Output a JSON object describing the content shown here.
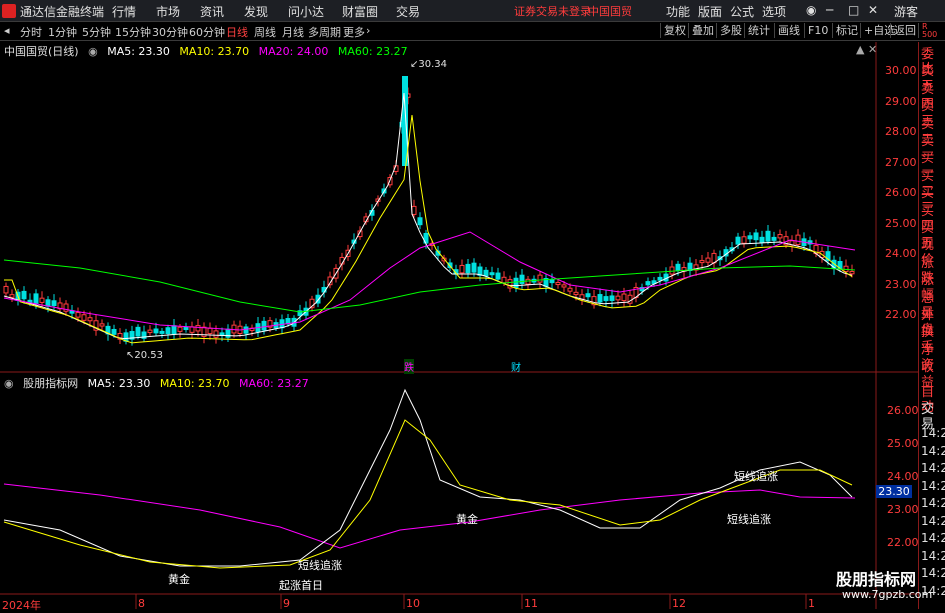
{
  "app": {
    "brand": "通达信金融终端",
    "account": "游客",
    "warn_text": "证券交易未登录",
    "warn_stock": "中国国贸"
  },
  "menu": [
    "行情",
    "市场",
    "资讯",
    "发现",
    "问小达",
    "财富圈",
    "交易"
  ],
  "menu_right": [
    "功能",
    "版面",
    "公式",
    "选项"
  ],
  "periods": [
    "分时",
    "1分钟",
    "5分钟",
    "15分钟",
    "30分钟",
    "60分钟",
    "日线",
    "周线",
    "月线",
    "多周期",
    "更多"
  ],
  "active_period": "日线",
  "tools": [
    "复权",
    "叠加",
    "多股",
    "统计",
    "画线",
    "F10",
    "标记",
    "+自选",
    "返回"
  ],
  "stock": {
    "title": "中国国贸(日线)"
  },
  "ma_legend": [
    {
      "label": "MA5: 23.30",
      "color": "#ffffff"
    },
    {
      "label": "MA10: 23.70",
      "color": "#ffff00"
    },
    {
      "label": "MA20: 24.00",
      "color": "#ff00ff"
    },
    {
      "label": "MA60: 23.27",
      "color": "#00ff00"
    }
  ],
  "indicator": {
    "title": "股朋指标网",
    "legend": [
      {
        "label": "MA5: 23.30",
        "color": "#ffffff"
      },
      {
        "label": "MA10: 23.70",
        "color": "#ffff00"
      },
      {
        "label": "MA60: 23.27",
        "color": "#ff00ff"
      }
    ],
    "current_value": "23.30",
    "signals": [
      "黄金",
      "起涨首日",
      "短线追涨",
      "黄金",
      "短线追涨",
      "短线追涨"
    ]
  },
  "price_axis": [
    "30.00",
    "29.00",
    "28.00",
    "27.00",
    "26.00",
    "25.00",
    "24.00",
    "23.00",
    "22.00"
  ],
  "indicator_axis": [
    "26.00",
    "25.00",
    "24.00",
    "23.00",
    "22.00"
  ],
  "high_label": "30.34",
  "low_label": "20.53",
  "markers": {
    "die": "跌",
    "cai": "财"
  },
  "x_ticks": [
    "2024年",
    "8",
    "9",
    "10",
    "11",
    "12",
    "1"
  ],
  "side_buttons": [
    "委比",
    "卖五",
    "卖四",
    "卖三",
    "卖二",
    "卖一",
    "买一",
    "买二",
    "买三",
    "买四",
    "买五",
    "现价",
    "涨跌",
    "涨幅",
    "总量",
    "外盘",
    "换手",
    "净资",
    "收益"
  ],
  "side_bottom": [
    "自动",
    "交易"
  ],
  "side_times": [
    "14:24",
    "14:24",
    "14:24",
    "14:24",
    "14:24",
    "14:24",
    "14:24",
    "14:24",
    "14:24",
    "14:24"
  ],
  "watermark": {
    "line1": "股朋指标网",
    "line2": "www.7gpzb.com"
  },
  "colors": {
    "up": "#ff3c3c",
    "down": "#00e0e0",
    "accent": "#ff3c3c"
  }
}
